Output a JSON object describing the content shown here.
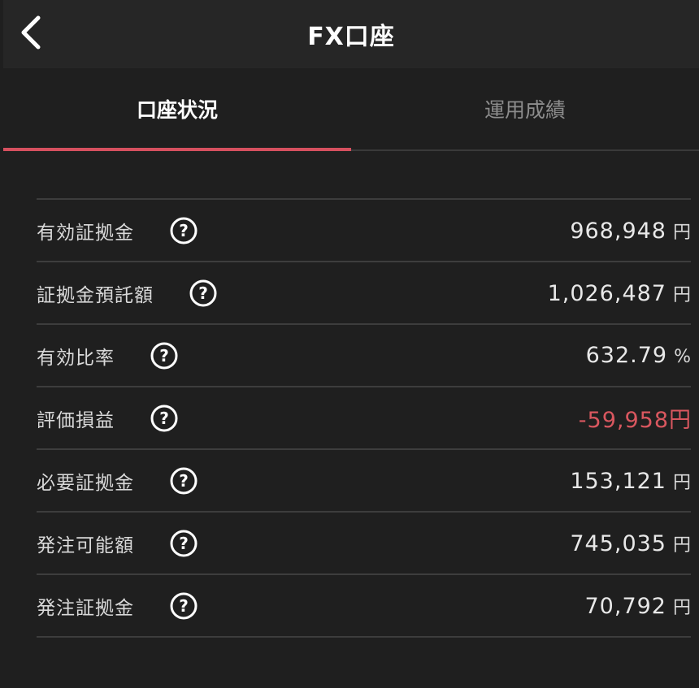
{
  "header": {
    "title": "FX口座"
  },
  "tabs": [
    {
      "label": "口座状況",
      "active": true
    },
    {
      "label": "運用成績",
      "active": false
    }
  ],
  "rows": [
    {
      "label": "有効証拠金",
      "value": "968,948",
      "unit": "円"
    },
    {
      "label": "証拠金預託額",
      "value": "1,026,487",
      "unit": "円"
    },
    {
      "label": "有効比率",
      "value": "632.79",
      "unit": "%"
    },
    {
      "label": "評価損益",
      "value": "-59,958",
      "unit": "円"
    },
    {
      "label": "必要証拠金",
      "value": "153,121",
      "unit": "円"
    },
    {
      "label": "発注可能額",
      "value": "745,035",
      "unit": "円"
    },
    {
      "label": "発注証拠金",
      "value": "70,792",
      "unit": "円"
    }
  ],
  "colors": {
    "accent": "#d6505f",
    "negative": "#d9575f",
    "background": "#1f1f1f",
    "header_bg": "#262626"
  },
  "icons": {
    "back": "chevron-left-icon",
    "help": "question-circle-icon"
  }
}
